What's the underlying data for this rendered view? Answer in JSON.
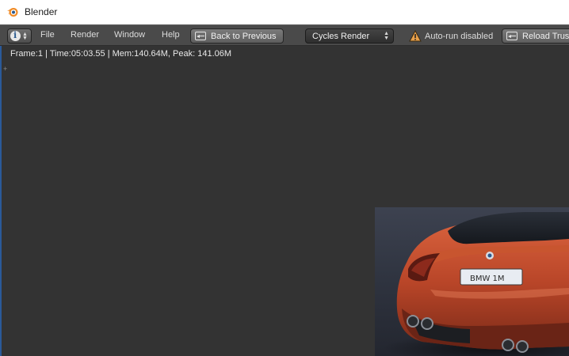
{
  "window": {
    "title": "Blender",
    "icon": "blender-logo-icon"
  },
  "header": {
    "editor_type_icon": "info-icon",
    "menus": [
      "File",
      "Render",
      "Window",
      "Help"
    ],
    "back_button_label": "Back to Previous",
    "render_engine": "Cycles Render",
    "warning_icon": "warning-triangle-icon",
    "warning_text": "Auto-run disabled",
    "reload_button_label": "Reload Trust"
  },
  "render_view": {
    "stats": "Frame:1 | Time:05:03.55 | Mem:140.64M, Peak: 141.06M",
    "image_alt": "Orange BMW car rear render"
  },
  "colors": {
    "header_bg": "#4a4a4a",
    "render_bg": "#333333",
    "car_body": "#c24a2b",
    "warning": "#e8a04a"
  }
}
